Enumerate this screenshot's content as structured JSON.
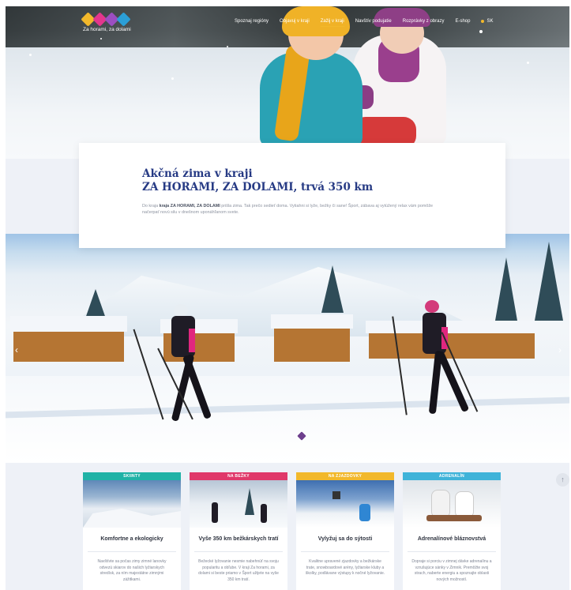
{
  "brand": {
    "logo_text": "Za horami, za dolami",
    "colors": [
      "#f2b82b",
      "#e3368d",
      "#9c4ec1",
      "#2b9fd8"
    ]
  },
  "nav": {
    "items": [
      "Spoznaj regióny",
      "Objavuj v kraji",
      "Zažij v kraji",
      "Navštív podujatie",
      "Rozprávky z obrazy",
      "E-shop"
    ],
    "active_index": 2,
    "language": "SK"
  },
  "intro": {
    "title_line1": "Akčná zima v kraji",
    "title_line2": "ZA HORAMI, ZA DOLAMI, trvá 350 km",
    "text_prefix": "Do kraja ",
    "text_bold": "kraja ZA HORAMI, ZA DOLAMI",
    "text_rest": " prišla zima. Tak prečo sedieť doma. Vytiahni si lyže, bežky či sane! Šport, zábava aj vytúžený relax vám pomôže načerpať novú silu v dnešnom uponáhľanom svete."
  },
  "slider": {
    "prev": "‹",
    "next": "›"
  },
  "tiles": [
    {
      "tag": "SKIINTY",
      "tag_color": "#20b2a6",
      "title": "Komfortne a ekologicky",
      "text": "Navštívte sa počas zimy zimné lanovky odvezú skiarov do našich lyžiarskych stredísk, za ním majestátne zimnými zážitkami."
    },
    {
      "tag": "NA BEŽKY",
      "tag_color": "#e0386a",
      "title": "Vyše 350 km bežkárskych tratí",
      "text": "Bežecké lyžovanie nesmie nabehnúť na svoju popularitu a obľube. V kraji Za horami, za dolami si beste priamo v Šport užijete na vyše 350 km tratí."
    },
    {
      "tag": "NA ZJAZDOVKY",
      "tag_color": "#f2b82b",
      "title": "Vylyžuj sa do sýtosti",
      "text": "Kvalitne upravené zjazdovky a bežkárske trate, snowboardové arény, lyžiarske kluby a školky, podlávane výstupy k nočné lyžovanie."
    },
    {
      "tag": "ADRENALÍN",
      "tag_color": "#3fb3d9",
      "title": "Adrenalínové bláznovstvá",
      "text": "Dopraje si porciu v zimnej dávke adrenalínu a vzrušujúce sánky v Zimnik. Premôžte svoj strach, naberte energiu a spoznajte oblasti nových možností."
    }
  ],
  "scroll_top": "↑"
}
